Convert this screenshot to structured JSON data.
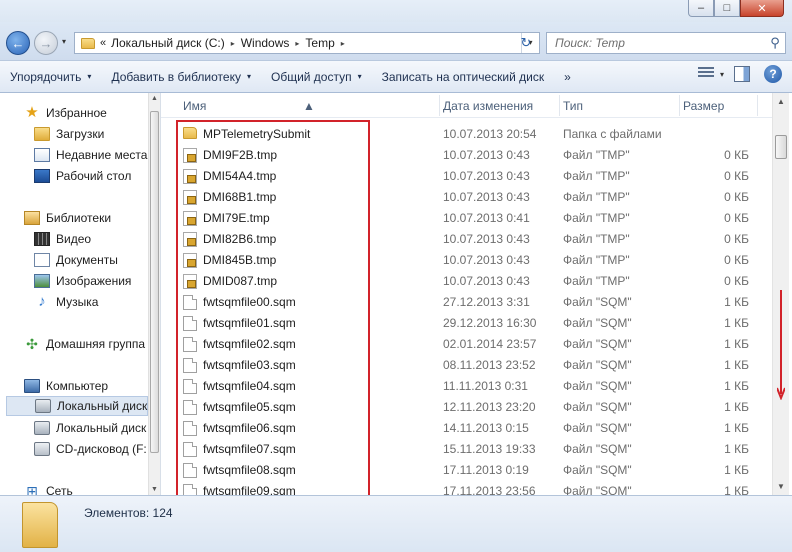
{
  "window": {
    "minimize": "–",
    "maximize": "□",
    "close": "✕"
  },
  "nav": {
    "back_icon": "←",
    "forward_icon": "→",
    "history_icon": "▾"
  },
  "address": {
    "overflow": "«",
    "crumbs": [
      "Локальный диск (C:)",
      "Windows",
      "Temp"
    ],
    "separator": "▸",
    "dropdown": "▾",
    "refresh_icon": "↻"
  },
  "search": {
    "placeholder": "Поиск: Temp",
    "icon": "⚲"
  },
  "toolbar": {
    "organize": "Упорядочить",
    "add_library": "Добавить в библиотеку",
    "share": "Общий доступ",
    "burn": "Записать на оптический диск",
    "more": "»",
    "arrow": "▾",
    "help": "?"
  },
  "sidebar": {
    "items": [
      {
        "label": "Избранное",
        "icon": "star-icon"
      },
      {
        "label": "Загрузки",
        "icon": "downloads-folder-icon"
      },
      {
        "label": "Недавние места",
        "icon": "recent-places-icon"
      },
      {
        "label": "Рабочий стол",
        "icon": "desktop-icon"
      },
      {
        "label": "Библиотеки",
        "icon": "libraries-icon"
      },
      {
        "label": "Видео",
        "icon": "video-icon"
      },
      {
        "label": "Документы",
        "icon": "documents-icon"
      },
      {
        "label": "Изображения",
        "icon": "images-icon"
      },
      {
        "label": "Музыка",
        "icon": "music-icon"
      },
      {
        "label": "Домашняя группа",
        "icon": "homegroup-icon"
      },
      {
        "label": "Компьютер",
        "icon": "computer-icon"
      },
      {
        "label": "Локальный диск",
        "icon": "drive-icon"
      },
      {
        "label": "Локальный диск",
        "icon": "drive-icon"
      },
      {
        "label": "CD-дисковод (F:",
        "icon": "cd-drive-icon"
      },
      {
        "label": "Сеть",
        "icon": "network-icon"
      }
    ]
  },
  "columns": {
    "name": "Имя",
    "date": "Дата изменения",
    "type": "Тип",
    "size": "Размер"
  },
  "files": [
    {
      "name": "MPTelemetrySubmit",
      "date": "10.07.2013 20:54",
      "type": "Папка с файлами",
      "size": "",
      "kind": "folder"
    },
    {
      "name": "DMI9F2B.tmp",
      "date": "10.07.2013 0:43",
      "type": "Файл \"TMP\"",
      "size": "0 КБ",
      "kind": "locked"
    },
    {
      "name": "DMI54A4.tmp",
      "date": "10.07.2013 0:43",
      "type": "Файл \"TMP\"",
      "size": "0 КБ",
      "kind": "locked"
    },
    {
      "name": "DMI68B1.tmp",
      "date": "10.07.2013 0:43",
      "type": "Файл \"TMP\"",
      "size": "0 КБ",
      "kind": "locked"
    },
    {
      "name": "DMI79E.tmp",
      "date": "10.07.2013 0:41",
      "type": "Файл \"TMP\"",
      "size": "0 КБ",
      "kind": "locked"
    },
    {
      "name": "DMI82B6.tmp",
      "date": "10.07.2013 0:43",
      "type": "Файл \"TMP\"",
      "size": "0 КБ",
      "kind": "locked"
    },
    {
      "name": "DMI845B.tmp",
      "date": "10.07.2013 0:43",
      "type": "Файл \"TMP\"",
      "size": "0 КБ",
      "kind": "locked"
    },
    {
      "name": "DMID087.tmp",
      "date": "10.07.2013 0:43",
      "type": "Файл \"TMP\"",
      "size": "0 КБ",
      "kind": "locked"
    },
    {
      "name": "fwtsqmfile00.sqm",
      "date": "27.12.2013 3:31",
      "type": "Файл \"SQM\"",
      "size": "1 КБ",
      "kind": "doc"
    },
    {
      "name": "fwtsqmfile01.sqm",
      "date": "29.12.2013 16:30",
      "type": "Файл \"SQM\"",
      "size": "1 КБ",
      "kind": "doc"
    },
    {
      "name": "fwtsqmfile02.sqm",
      "date": "02.01.2014 23:57",
      "type": "Файл \"SQM\"",
      "size": "1 КБ",
      "kind": "doc"
    },
    {
      "name": "fwtsqmfile03.sqm",
      "date": "08.11.2013 23:52",
      "type": "Файл \"SQM\"",
      "size": "1 КБ",
      "kind": "doc"
    },
    {
      "name": "fwtsqmfile04.sqm",
      "date": "11.11.2013 0:31",
      "type": "Файл \"SQM\"",
      "size": "1 КБ",
      "kind": "doc"
    },
    {
      "name": "fwtsqmfile05.sqm",
      "date": "12.11.2013 23:20",
      "type": "Файл \"SQM\"",
      "size": "1 КБ",
      "kind": "doc"
    },
    {
      "name": "fwtsqmfile06.sqm",
      "date": "14.11.2013 0:15",
      "type": "Файл \"SQM\"",
      "size": "1 КБ",
      "kind": "doc"
    },
    {
      "name": "fwtsqmfile07.sqm",
      "date": "15.11.2013 19:33",
      "type": "Файл \"SQM\"",
      "size": "1 КБ",
      "kind": "doc"
    },
    {
      "name": "fwtsqmfile08.sqm",
      "date": "17.11.2013 0:19",
      "type": "Файл \"SQM\"",
      "size": "1 КБ",
      "kind": "doc"
    },
    {
      "name": "fwtsqmfile09.sqm",
      "date": "17.11.2013 23:56",
      "type": "Файл \"SQM\"",
      "size": "1 КБ",
      "kind": "doc"
    }
  ],
  "status": {
    "items": "Элементов: 124"
  },
  "colors": {
    "annotation_red": "#d2232a",
    "selection": "#dde7f3"
  }
}
